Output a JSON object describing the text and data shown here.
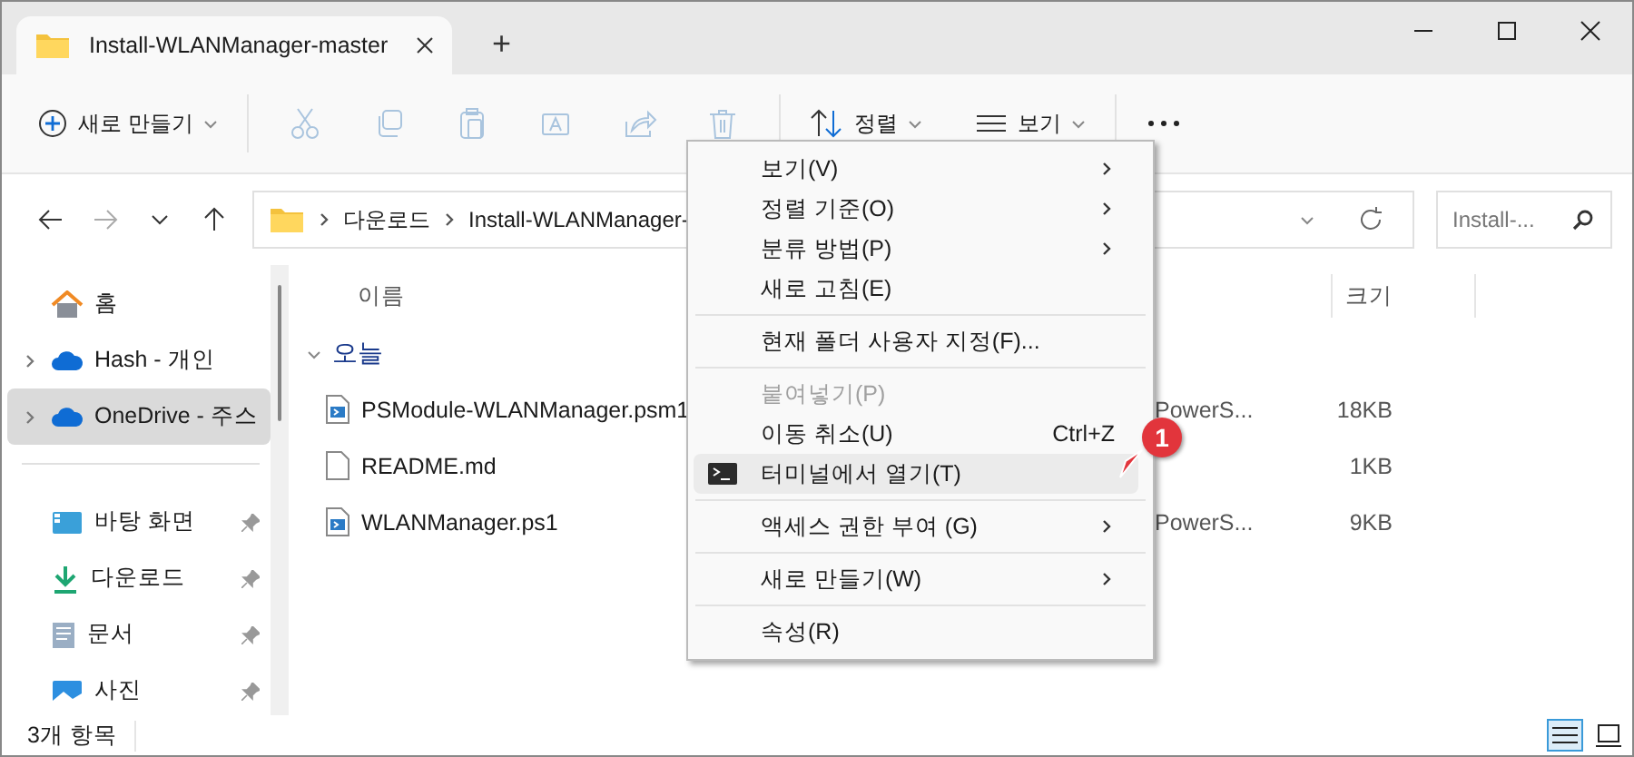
{
  "window": {
    "tab_title": "Install-WLANManager-master",
    "new_tab": "+"
  },
  "toolbar": {
    "new_label": "새로 만들기",
    "actions": [
      {
        "kind": "cut",
        "disabled": true
      },
      {
        "kind": "copy",
        "disabled": true
      },
      {
        "kind": "paste",
        "disabled": true
      },
      {
        "kind": "rename",
        "disabled": true
      },
      {
        "kind": "share",
        "disabled": true
      },
      {
        "kind": "delete",
        "disabled": true
      }
    ],
    "sort_label": "정렬",
    "view_label": "보기"
  },
  "address": {
    "crumbs": [
      "다운로드",
      "Install-WLANManager-"
    ]
  },
  "search": {
    "placeholder": "Install-..."
  },
  "sidebar": {
    "items": [
      {
        "kind": "home",
        "label": "홈",
        "expandable": false,
        "pinned": false,
        "selected": false
      },
      {
        "kind": "cloud",
        "label": "Hash - 개인",
        "expandable": true,
        "pinned": false,
        "selected": false
      },
      {
        "kind": "cloud",
        "label": "OneDrive - 주스",
        "expandable": true,
        "pinned": false,
        "selected": true
      },
      {
        "kind": "divider"
      },
      {
        "kind": "desktop",
        "label": "바탕 화면",
        "expandable": false,
        "pinned": true,
        "selected": false
      },
      {
        "kind": "downloads",
        "label": "다운로드",
        "expandable": false,
        "pinned": true,
        "selected": false
      },
      {
        "kind": "documents",
        "label": "문서",
        "expandable": false,
        "pinned": true,
        "selected": false
      },
      {
        "kind": "pictures",
        "label": "사진",
        "expandable": false,
        "pinned": true,
        "selected": false
      }
    ]
  },
  "columns": {
    "name": "이름",
    "size": "크기"
  },
  "groups": [
    {
      "label": "오늘",
      "expanded": true,
      "files": [
        {
          "kind": "script",
          "name": "PSModule-WLANManager.psm1",
          "type": "PowerS...",
          "size": "18KB"
        },
        {
          "kind": "document",
          "name": "README.md",
          "size": "1KB"
        },
        {
          "kind": "script",
          "name": "WLANManager.ps1",
          "type": "PowerS...",
          "size": "9KB"
        }
      ]
    }
  ],
  "context_menu": {
    "items": [
      {
        "kind": "item",
        "label": "보기(V)",
        "submenu": true,
        "disabled": false,
        "selected": false
      },
      {
        "kind": "item",
        "label": "정렬 기준(O)",
        "submenu": true,
        "disabled": false,
        "selected": false
      },
      {
        "kind": "item",
        "label": "분류 방법(P)",
        "submenu": true,
        "disabled": false,
        "selected": false
      },
      {
        "kind": "item",
        "label": "새로 고침(E)",
        "submenu": false,
        "disabled": false,
        "selected": false
      },
      {
        "kind": "separator"
      },
      {
        "kind": "item",
        "label": "현재 폴더 사용자 지정(F)...",
        "submenu": false,
        "disabled": false,
        "selected": false
      },
      {
        "kind": "separator"
      },
      {
        "kind": "item",
        "label": "붙여넣기(P)",
        "submenu": false,
        "disabled": true,
        "selected": false
      },
      {
        "kind": "item",
        "label": "이동 취소(U)",
        "shortcut": "Ctrl+Z",
        "submenu": false,
        "disabled": false,
        "selected": false
      },
      {
        "kind": "terminal",
        "label": "터미널에서 열기(T)",
        "submenu": false,
        "disabled": false,
        "selected": true
      },
      {
        "kind": "separator"
      },
      {
        "kind": "item",
        "label": "액세스 권한 부여 (G)",
        "submenu": true,
        "disabled": false,
        "selected": false
      },
      {
        "kind": "separator"
      },
      {
        "kind": "item",
        "label": "새로 만들기(W)",
        "submenu": true,
        "disabled": false,
        "selected": false
      },
      {
        "kind": "separator"
      },
      {
        "kind": "item",
        "label": "속성(R)",
        "submenu": false,
        "disabled": false,
        "selected": false
      }
    ]
  },
  "annotation": {
    "badge": "1"
  },
  "status_bar": {
    "count": "3개 항목",
    "views": [
      {
        "kind": "details",
        "selected": true
      },
      {
        "kind": "tiles",
        "selected": false
      }
    ]
  }
}
